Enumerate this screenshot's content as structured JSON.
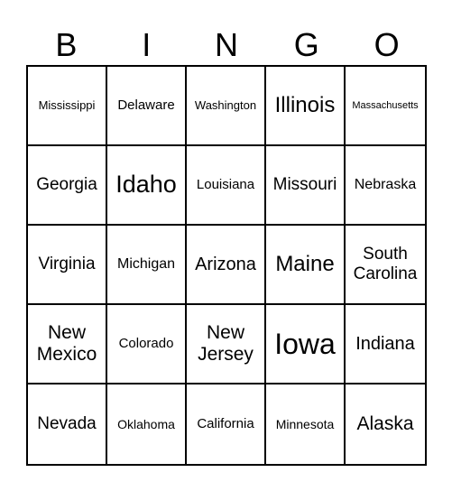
{
  "header": [
    "B",
    "I",
    "N",
    "G",
    "O"
  ],
  "cells": [
    [
      "Mississippi",
      "Delaware",
      "Washington",
      "Illinois",
      "Massachusetts"
    ],
    [
      "Georgia",
      "Idaho",
      "Louisiana",
      "Missouri",
      "Nebraska"
    ],
    [
      "Virginia",
      "Michigan",
      "Arizona",
      "Maine",
      "South Carolina"
    ],
    [
      "New Mexico",
      "Colorado",
      "New Jersey",
      "Iowa",
      "Indiana"
    ],
    [
      "Nevada",
      "Oklahoma",
      "California",
      "Minnesota",
      "Alaska"
    ]
  ]
}
